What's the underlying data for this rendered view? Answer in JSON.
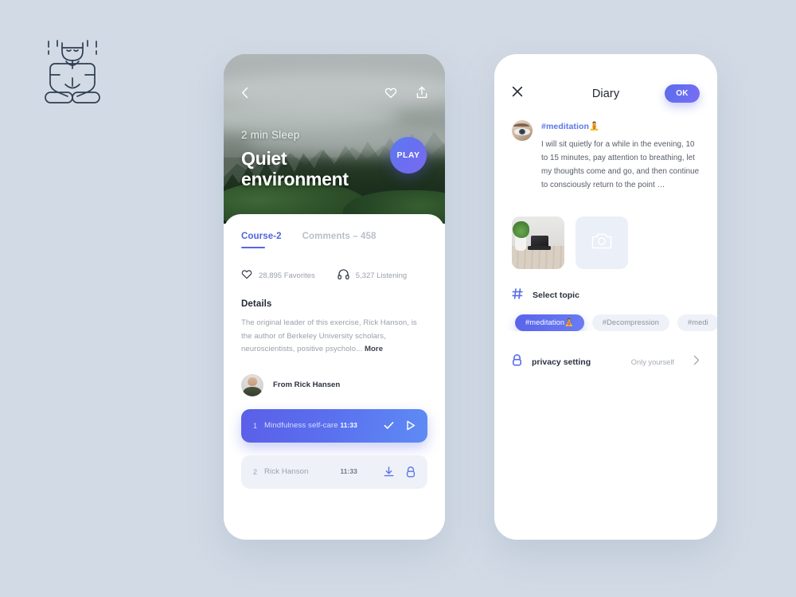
{
  "brand": {
    "logo_name": "meditating-figure-logo"
  },
  "left_phone": {
    "hero": {
      "back_icon": "chevron-left-icon",
      "favorite_icon": "heart-outline-icon",
      "share_icon": "share-upload-icon",
      "kicker": "2 min Sleep",
      "title_line1": "Quiet",
      "title_line2": "environment",
      "play_label": "PLAY"
    },
    "tabs": [
      {
        "label": "Course-2",
        "active": true
      },
      {
        "label": "Comments – 458",
        "active": false
      }
    ],
    "stats": [
      {
        "icon": "heart-outline-icon",
        "text": "28,895 Favorites"
      },
      {
        "icon": "headphones-icon",
        "text": "5,327 Listening"
      }
    ],
    "details": {
      "heading": "Details",
      "body": "The original leader of this exercise, Rick Hanson, is the author of Berkeley University scholars, neuroscientists, positive psycholo...",
      "more_label": "More"
    },
    "author": {
      "name": "From Rick Hansen",
      "avatar": "rick-hansen-avatar"
    },
    "tracks": [
      {
        "num": "1",
        "name": "Mindfulness self-care",
        "time": "11:33",
        "icon1": "check-icon",
        "icon2": "play-triangle-icon",
        "active": true
      },
      {
        "num": "2",
        "name": "Rick Hanson",
        "time": "11:33",
        "icon1": "download-icon",
        "icon2": "lock-icon",
        "active": false
      }
    ]
  },
  "right_phone": {
    "header": {
      "close_icon": "close-x-icon",
      "title": "Diary",
      "ok_label": "OK"
    },
    "entry": {
      "avatar": "eye-closeup-avatar",
      "tag": "#meditation🧘",
      "text": "I will sit quietly for a while in the evening, 10 to 15 minutes, pay attention to breathing, let my thoughts come and go, and then continue to consciously return to the point …"
    },
    "photos": {
      "thumb_name": "desk-plant-photo",
      "add_icon": "camera-icon"
    },
    "topic": {
      "hash_icon": "hash-icon",
      "label": "Select topic",
      "chips": [
        {
          "label": "#meditation🧘",
          "active": true
        },
        {
          "label": "#Decompression",
          "active": false
        },
        {
          "label": "#medi",
          "active": false
        }
      ]
    },
    "privacy": {
      "lock_icon": "lock-icon",
      "label": "privacy setting",
      "value": "Only yourself",
      "chevron_icon": "chevron-right-icon"
    }
  },
  "colors": {
    "background": "#d2dae5",
    "accent": "#5a6ceb",
    "accent_alt": "#7a6cf3",
    "muted_text": "#9aa0ac",
    "dark_text": "#2b3140"
  }
}
